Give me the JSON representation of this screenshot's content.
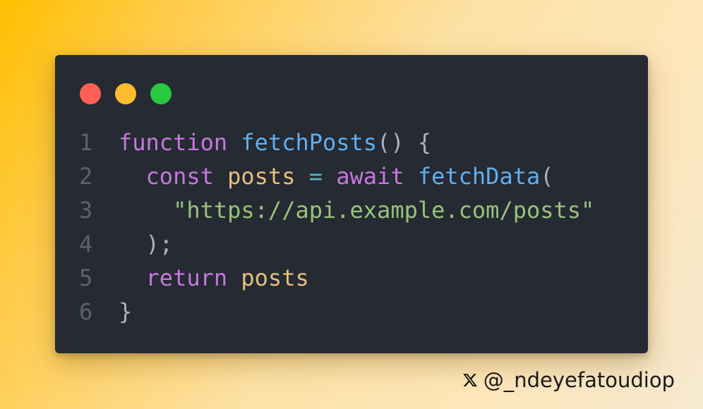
{
  "window": {
    "dots": [
      {
        "name": "close",
        "color": "#ff5f57"
      },
      {
        "name": "minimize",
        "color": "#febc2e"
      },
      {
        "name": "maximize",
        "color": "#28c840"
      }
    ]
  },
  "code": {
    "lines": [
      {
        "number": "1",
        "tokens": [
          {
            "text": "function",
            "kind": "kw"
          },
          {
            "text": " ",
            "kind": "punc"
          },
          {
            "text": "fetchPosts",
            "kind": "fn"
          },
          {
            "text": "() {",
            "kind": "punc"
          }
        ]
      },
      {
        "number": "2",
        "tokens": [
          {
            "text": "  ",
            "kind": "punc"
          },
          {
            "text": "const",
            "kind": "kw"
          },
          {
            "text": " ",
            "kind": "punc"
          },
          {
            "text": "posts",
            "kind": "var"
          },
          {
            "text": " ",
            "kind": "punc"
          },
          {
            "text": "=",
            "kind": "op"
          },
          {
            "text": " ",
            "kind": "punc"
          },
          {
            "text": "await",
            "kind": "kw"
          },
          {
            "text": " ",
            "kind": "punc"
          },
          {
            "text": "fetchData",
            "kind": "fn"
          },
          {
            "text": "(",
            "kind": "punc"
          }
        ]
      },
      {
        "number": "3",
        "tokens": [
          {
            "text": "    ",
            "kind": "punc"
          },
          {
            "text": "\"https://api.example.com/posts\"",
            "kind": "str"
          }
        ]
      },
      {
        "number": "4",
        "tokens": [
          {
            "text": "  );",
            "kind": "punc"
          }
        ]
      },
      {
        "number": "5",
        "tokens": [
          {
            "text": "  ",
            "kind": "punc"
          },
          {
            "text": "return",
            "kind": "kw"
          },
          {
            "text": " ",
            "kind": "punc"
          },
          {
            "text": "posts",
            "kind": "var"
          }
        ]
      },
      {
        "number": "6",
        "tokens": [
          {
            "text": "}",
            "kind": "punc"
          }
        ]
      }
    ]
  },
  "credit": {
    "icon": "x-logo-icon",
    "handle": "@_ndeyefatoudiop"
  }
}
